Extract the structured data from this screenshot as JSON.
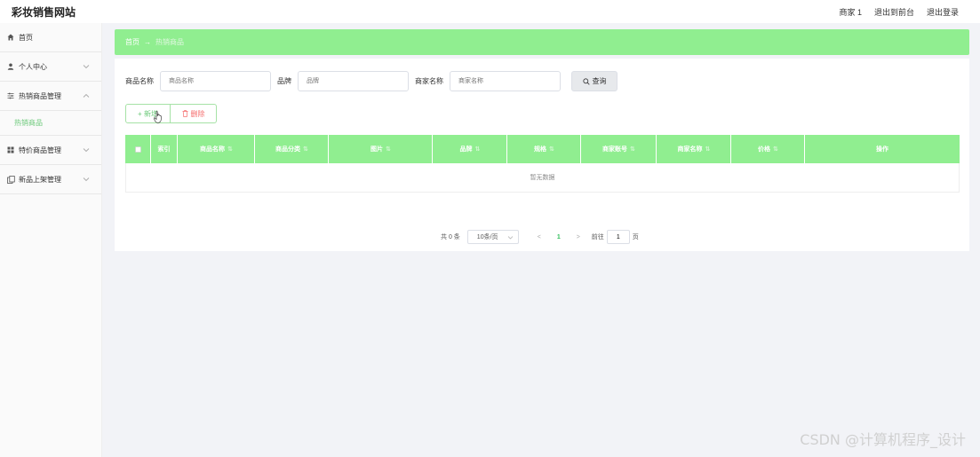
{
  "header": {
    "brand": "彩妆销售网站",
    "user": "商家 1",
    "to_front": "退出到前台",
    "logout": "退出登录"
  },
  "sidebar": {
    "home": "首页",
    "items": [
      {
        "label": "个人中心",
        "icon": "user-icon"
      },
      {
        "label": "热销商品管理",
        "icon": "sliders-icon",
        "expanded": true,
        "children": [
          "热销商品"
        ]
      },
      {
        "label": "特价商品管理",
        "icon": "grid-icon"
      },
      {
        "label": "新品上架管理",
        "icon": "copy-icon"
      }
    ]
  },
  "breadcrumb": {
    "home": "首页",
    "sep": "→",
    "current": "热销商品"
  },
  "search": {
    "name_label": "商品名称",
    "name_placeholder": "商品名称",
    "brand_label": "品牌",
    "brand_placeholder": "品牌",
    "merchant_label": "商家名称",
    "merchant_placeholder": "商家名称",
    "button": "查询"
  },
  "actions": {
    "add": "+ 新增",
    "delete": "删除"
  },
  "table": {
    "columns": [
      "",
      "索引",
      "商品名称",
      "商品分类",
      "图片",
      "品牌",
      "规格",
      "商家账号",
      "商家名称",
      "价格",
      "操作"
    ],
    "empty": "暂无数据"
  },
  "pager": {
    "total": "共 0 条",
    "page_size": "10条/页",
    "prev": "<",
    "current": "1",
    "next": ">",
    "goto": "前往",
    "page_input": "1",
    "page_unit": "页"
  },
  "watermark": "CSDN @计算机程序_设计",
  "colors": {
    "accent": "#90ee90",
    "active_text": "#6cc97a",
    "danger": "#f56c6c"
  }
}
